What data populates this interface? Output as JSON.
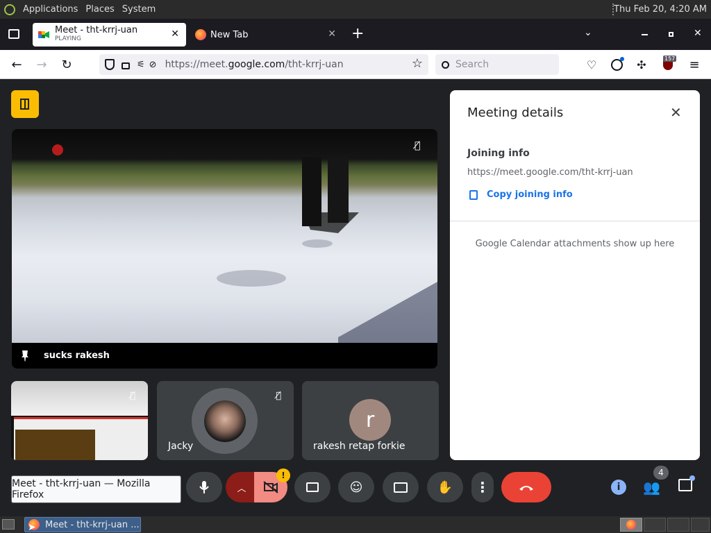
{
  "system_panel": {
    "menus": [
      "Applications",
      "Places",
      "System"
    ],
    "clock": "Thu Feb 20, 4:20 AM"
  },
  "browser": {
    "tabs": [
      {
        "title": "Meet - tht-krrj-uan",
        "subtitle": "PLAYING",
        "icon": "google-meet-icon"
      },
      {
        "title": "New Tab",
        "icon": "firefox-icon"
      }
    ],
    "url_prefix": "https://meet.",
    "url_domain": "google.com",
    "url_path": "/tht-krrj-uan",
    "search_placeholder": "Search",
    "extensions_badge": "157"
  },
  "meet": {
    "main_tile": {
      "name": "sucks rakesh"
    },
    "tiles": [
      {
        "name": ""
      },
      {
        "name": "Jacky"
      },
      {
        "name": "rakesh retap forkie",
        "avatar_letter": "r"
      }
    ],
    "details": {
      "title": "Meeting details",
      "joining_label": "Joining info",
      "link": "https://meet.google.com/tht-krrj-uan",
      "copy_label": "Copy joining info",
      "attachments_note": "Google Calendar attachments show up here"
    },
    "people_count": "4",
    "camera_warning": "!",
    "tooltip": "Meet - tht-krrj-uan — Mozilla Firefox"
  },
  "taskbar": {
    "window_label": "Meet - tht-krrj-uan ..."
  },
  "colors": {
    "meet_bg": "#202124",
    "tile_bg": "#3c4043",
    "hangup_red": "#ea4335",
    "accent_blue": "#1a73e8",
    "yellow": "#fbbc04"
  }
}
